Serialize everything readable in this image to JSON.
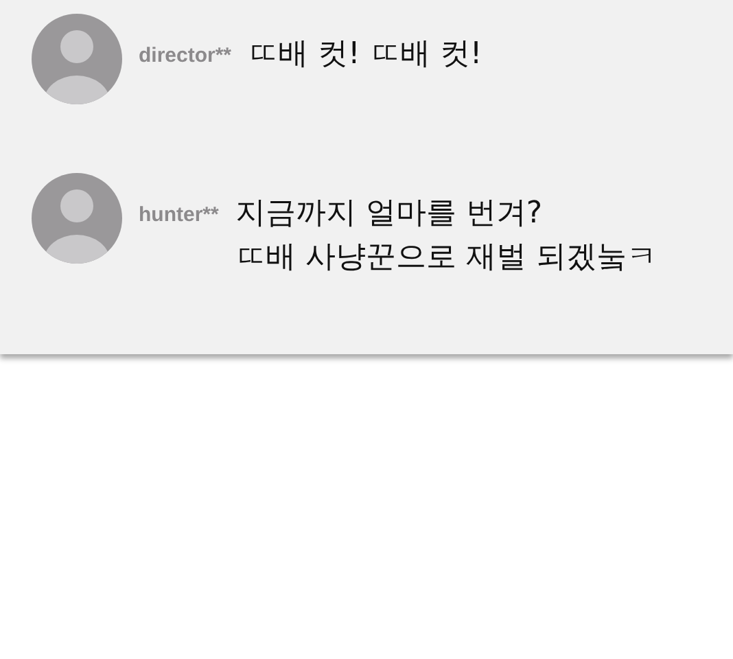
{
  "comments": [
    {
      "user": "director**",
      "lines": [
        "ㄸ배 컷! ㄸ배 컷!"
      ]
    },
    {
      "user": "hunter**",
      "lines": [
        "지금까지 얼마를 번겨?",
        "ㄸ배 사냥꾼으로 재벌 되겠눜ㅋ"
      ]
    }
  ]
}
